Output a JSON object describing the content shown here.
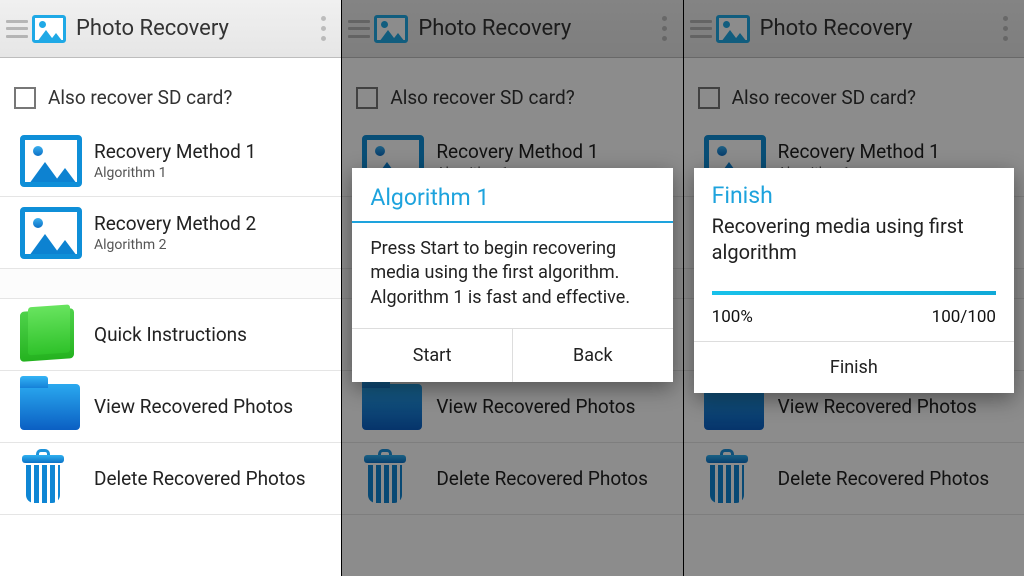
{
  "app": {
    "title": "Photo Recovery"
  },
  "checkbox": {
    "label": "Also recover SD card?"
  },
  "methods": [
    {
      "label": "Recovery Method 1",
      "sub": "Algorithm 1"
    },
    {
      "label": "Recovery Method 2",
      "sub": "Algorithm 2"
    }
  ],
  "actions": {
    "instructions": "Quick Instructions",
    "view": "View Recovered Photos",
    "delete": "Delete Recovered Photos"
  },
  "dialog": {
    "title": "Algorithm 1",
    "body": "Press Start to begin recovering media using the first algorithm. Algorithm 1 is fast and effective.",
    "start": "Start",
    "back": "Back"
  },
  "progress": {
    "title": "Finish",
    "msg": "Recovering media using first algorithm",
    "percent": "100%",
    "count": "100/100",
    "finish": "Finish"
  }
}
